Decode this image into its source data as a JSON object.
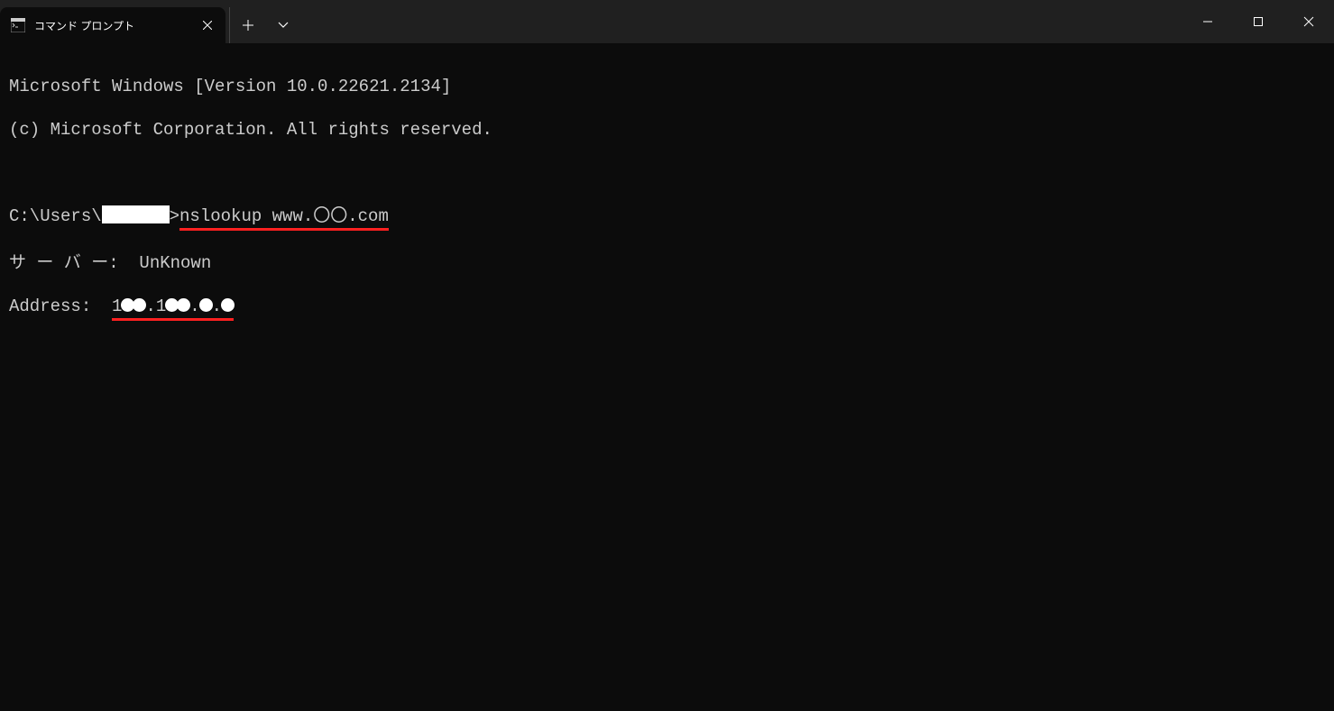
{
  "titlebar": {
    "tab_title": "コマンド プロンプト"
  },
  "terminal": {
    "line1": "Microsoft Windows [Version 10.0.22621.2134]",
    "line2": "(c) Microsoft Corporation. All rights reserved.",
    "prompt_path": "C:\\Users\\",
    "prompt_gt": ">",
    "command": "nslookup www.〇〇.com",
    "server_label": "サ ー バ ー:  ",
    "server_value": "UnKnown",
    "address_label": "Address:  ",
    "ip_part1": "1",
    "ip_dot1": ".",
    "ip_part2": "1",
    "ip_dot2": ".",
    "ip_dot3": "."
  },
  "colors": {
    "underline": "#ff2020",
    "redaction": "#ffffff"
  }
}
